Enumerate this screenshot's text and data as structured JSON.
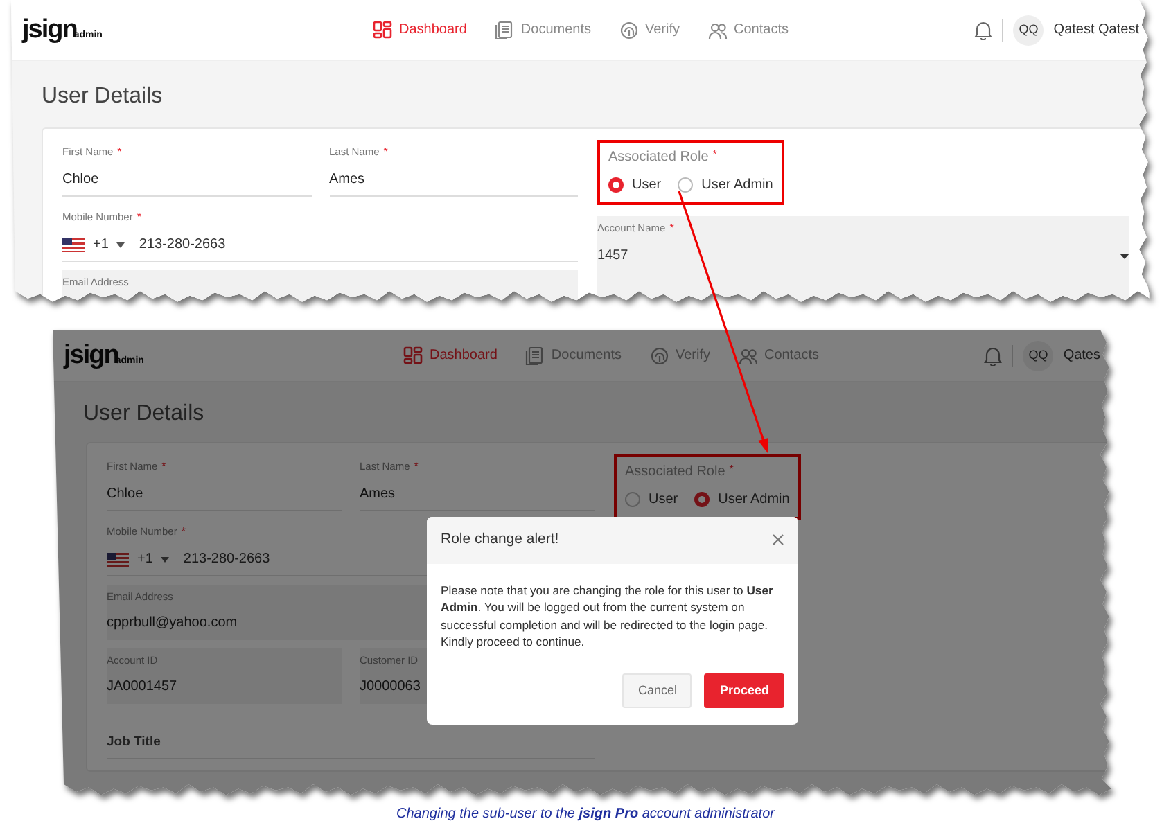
{
  "screenshots": [
    {
      "app": {
        "logo": {
          "main": "jsign",
          "sub": "admin"
        },
        "nav": [
          {
            "label": "Dashboard",
            "selected": true
          },
          {
            "label": "Documents",
            "selected": false
          },
          {
            "label": "Verify",
            "selected": false
          },
          {
            "label": "Contacts",
            "selected": false
          }
        ],
        "user": {
          "initials": "QQ",
          "name": "Qatest Qatest"
        }
      },
      "page_title": "User Details",
      "left_rows": [
        [
          {
            "kind": "text",
            "label": "First Name",
            "required_mark": "*",
            "value": "Chloe"
          },
          {
            "kind": "text",
            "label": "Last Name",
            "required_mark": "*",
            "value": "Ames"
          }
        ],
        [
          {
            "kind": "phone",
            "label": "Mobile Number",
            "required_mark": "*",
            "dial_code": "+1",
            "value": "213-280-2663"
          }
        ],
        [
          {
            "kind": "readonly",
            "label": "Email Address"
          }
        ]
      ],
      "role": {
        "label": "Associated Role",
        "required_mark": "*",
        "highlighted": true,
        "options": [
          {
            "label": "User",
            "selected": true
          },
          {
            "label": "User Admin",
            "selected": false
          }
        ]
      },
      "right_fields": [
        {
          "kind": "select",
          "label": "Account Name",
          "required_mark": "*",
          "value": "1457"
        }
      ],
      "backdrop": false
    },
    {
      "app": {
        "logo": {
          "main": "jsign",
          "sub": "admin"
        },
        "nav": [
          {
            "label": "Dashboard",
            "selected": true
          },
          {
            "label": "Documents",
            "selected": false
          },
          {
            "label": "Verify",
            "selected": false
          },
          {
            "label": "Contacts",
            "selected": false
          }
        ],
        "user": {
          "initials": "QQ",
          "name": "Qates"
        }
      },
      "page_title": "User Details",
      "left_rows": [
        [
          {
            "kind": "text",
            "label": "First Name",
            "required_mark": "*",
            "value": "Chloe"
          },
          {
            "kind": "text",
            "label": "Last Name",
            "required_mark": "*",
            "value": "Ames"
          }
        ],
        [
          {
            "kind": "phone",
            "label": "Mobile Number",
            "required_mark": "*",
            "dial_code": "+1",
            "value": "213-280-2663"
          }
        ],
        [
          {
            "kind": "readonly",
            "label": "Email Address",
            "value": "cpprbull@yahoo.com"
          }
        ],
        [
          {
            "kind": "readonly",
            "label": "Account ID",
            "value": "JA0001457"
          },
          {
            "kind": "readonly",
            "label": "Customer ID",
            "value": "J0000063"
          }
        ],
        [
          {
            "kind": "heading",
            "label": "Job Title"
          }
        ]
      ],
      "role": {
        "label": "Associated Role",
        "required_mark": "*",
        "highlighted": true,
        "options": [
          {
            "label": "User",
            "selected": false
          },
          {
            "label": "User Admin",
            "selected": true
          }
        ]
      },
      "backdrop": true,
      "dialog": {
        "title": "Role change alert!",
        "message": "Please note that you are changing the role for this user to **User Admin**. You will be logged out from the current system on successful completion and will be redirected to the login page. Kindly proceed to continue.",
        "buttons": [
          {
            "label": "Cancel",
            "kind": "secondary"
          },
          {
            "label": "Proceed",
            "kind": "primary"
          }
        ]
      }
    }
  ],
  "caption": "Changing the sub-user to the **jsign Pro** account administrator"
}
